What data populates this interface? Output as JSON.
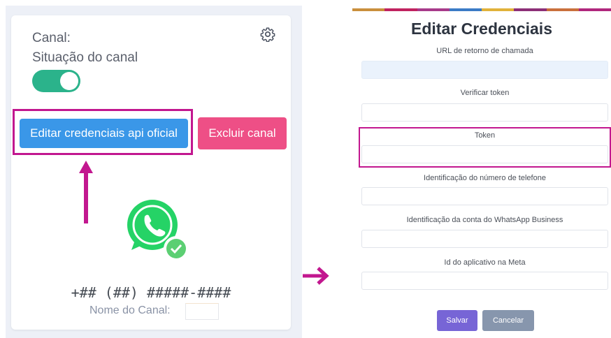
{
  "left_panel": {
    "canal_label": "Canal: ",
    "situacao_label": "Situação do canal",
    "toggle_state": "on",
    "edit_button": "Editar credenciais api oficial",
    "delete_button": "Excluir canal",
    "phone_number": "+## (##) #####-####",
    "nome_label": "Nome do Canal:",
    "icons": [
      "gear-icon",
      "whatsapp-icon",
      "check-badge-icon",
      "arrow-up-icon"
    ]
  },
  "colors": {
    "toggle": "#2bb38b",
    "edit_button": "#3a97e8",
    "delete_button": "#ee4f86",
    "highlight": "#c2178f",
    "salvar": "#7765d6",
    "cancelar": "#8796ad",
    "whatsapp": "#25d366"
  },
  "right_panel": {
    "title": "Editar Credenciais",
    "fields": [
      {
        "label": "URL de retorno de chamada",
        "value": ""
      },
      {
        "label": "Verificar token",
        "value": ""
      },
      {
        "label": "Token",
        "value": ""
      },
      {
        "label": "Identificação do número de telefone",
        "value": ""
      },
      {
        "label": "Identificação da conta do WhatsApp Business",
        "value": ""
      },
      {
        "label": "Id do aplicativo na Meta",
        "value": ""
      }
    ],
    "salvar_button": "Salvar",
    "cancelar_button": "Cancelar"
  }
}
